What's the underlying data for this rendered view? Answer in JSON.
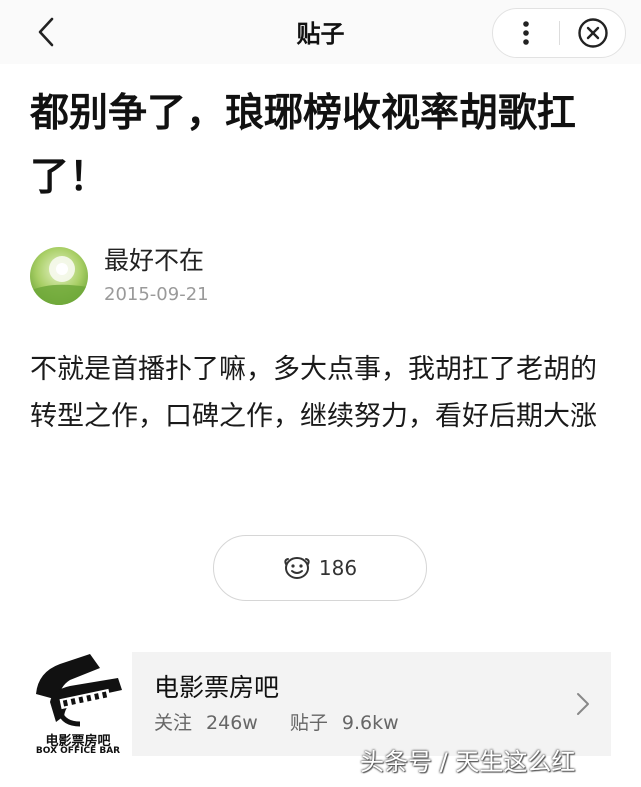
{
  "nav": {
    "title": "贴子",
    "back_icon": "chevron-left-icon",
    "more_icon": "more-vertical-icon",
    "close_icon": "close-circle-icon"
  },
  "post": {
    "title": "都别争了，琅琊榜收视率胡歌扛了！",
    "author": "最好不在",
    "date": "2015-09-21",
    "body": "不就是首播扑了嘛，多大点事，我胡扛了老胡的转型之作，口碑之作，继续努力，看好后期大涨",
    "like_count": "186",
    "like_icon": "emoji-icon"
  },
  "forum": {
    "name": "电影票房吧",
    "follow_label": "关注",
    "follow_count": "246w",
    "posts_label": "贴子",
    "posts_count": "9.6kw",
    "logo_text_cn": "电影票房吧",
    "logo_text_en": "BOX OFFICE BAR"
  },
  "watermark": "头条号 / 天生这么红"
}
